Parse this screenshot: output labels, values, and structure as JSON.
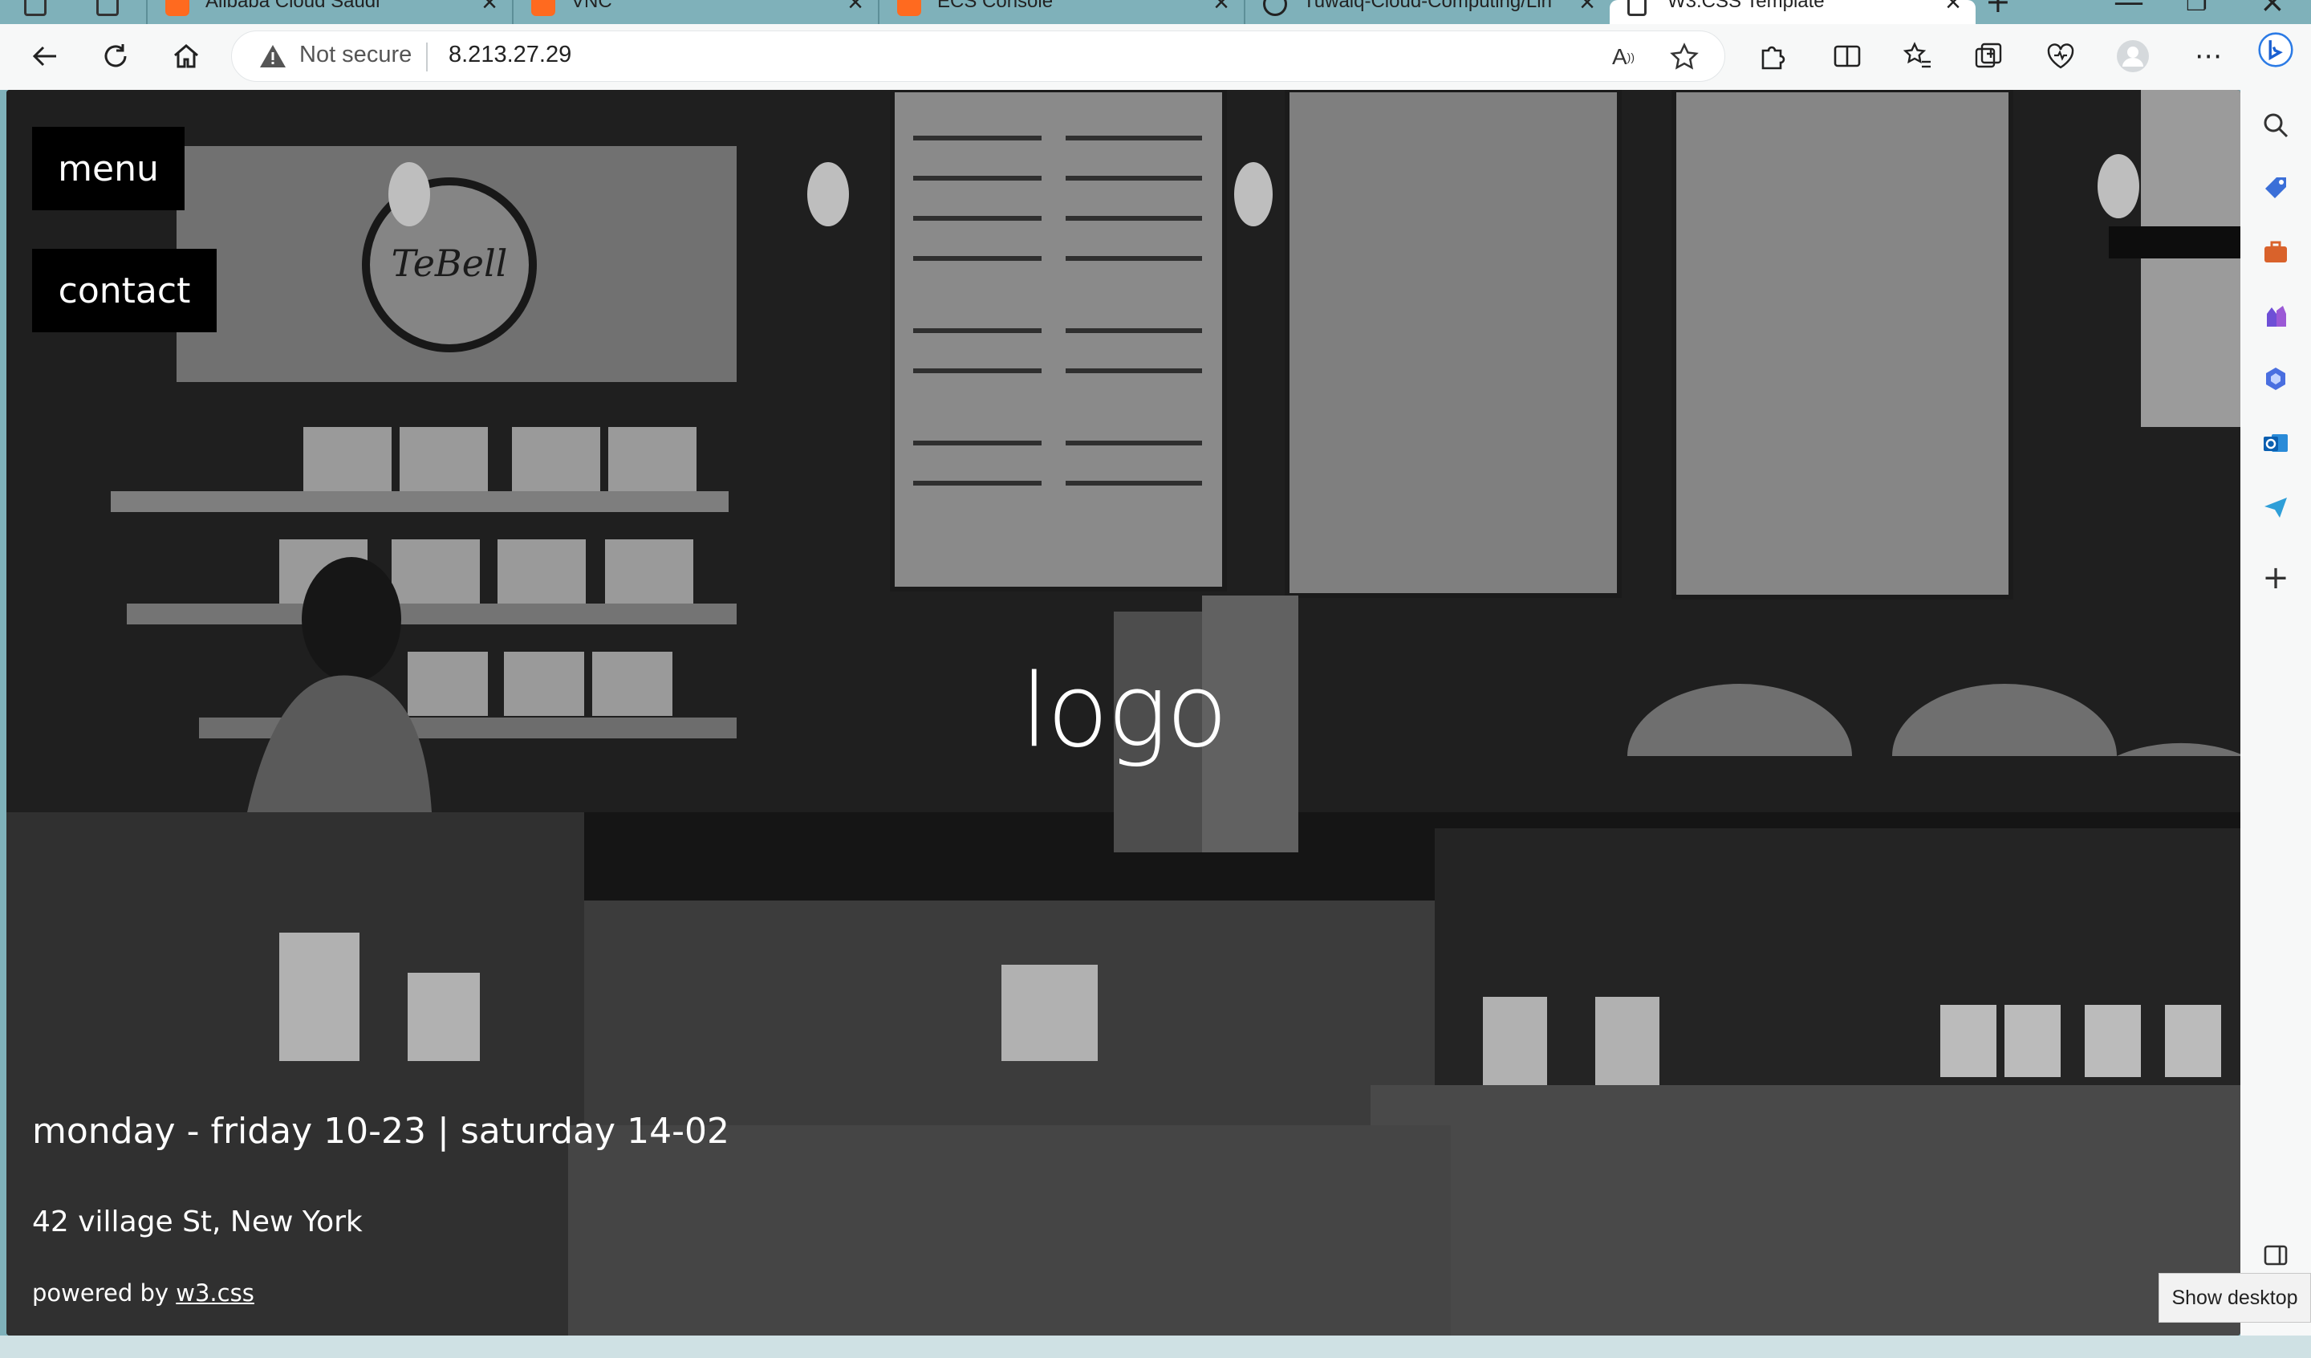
{
  "browser": {
    "tabs": [
      {
        "title": "Alibaba Cloud Saudi",
        "favicon": "alibaba-icon"
      },
      {
        "title": "VNC",
        "favicon": "alibaba-icon"
      },
      {
        "title": "ECS Console",
        "favicon": "alibaba-icon"
      },
      {
        "title": "Tuwaiq-Cloud-Computing/Lin",
        "favicon": "github-icon"
      },
      {
        "title": "W3.CSS Template",
        "favicon": "page-icon",
        "active": true
      }
    ],
    "address": {
      "security_label": "Not secure",
      "url": "8.213.27.29"
    }
  },
  "page": {
    "nav": {
      "menu_label": "menu",
      "contact_label": "contact"
    },
    "logo_text": "logo",
    "hours": "monday - friday 10-23 | saturday 14-02",
    "address": "42 village St, New York",
    "powered_prefix": "powered by ",
    "powered_link": "w3.css"
  },
  "taskbar": {
    "show_desktop_tooltip": "Show desktop"
  },
  "colors": {
    "tab_strip": "#7fb1ba",
    "toolbar": "#f7f8f8",
    "nav_button_bg": "#000000",
    "text": "#ffffff"
  }
}
